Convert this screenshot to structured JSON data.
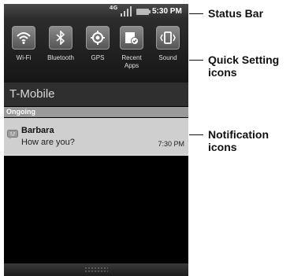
{
  "status_bar": {
    "time": "5:30 PM",
    "network_badge": "4G"
  },
  "quick_settings": [
    {
      "label": "Wi-Fi",
      "icon": "wifi-icon"
    },
    {
      "label": "Bluetooth",
      "icon": "bluetooth-icon"
    },
    {
      "label": "GPS",
      "icon": "gps-icon"
    },
    {
      "label": "Recent\nApps",
      "icon": "recent-apps-icon"
    },
    {
      "label": "Sound",
      "icon": "sound-vibrate-icon"
    }
  ],
  "carrier": "T-Mobile",
  "ongoing_header": "Ongoing",
  "notification": {
    "title": "Barbara",
    "text": "How are you?",
    "time": "7:30 PM"
  },
  "callouts": {
    "status_bar": "Status Bar",
    "quick_settings": "Quick Setting icons",
    "notifications": "Notification icons"
  }
}
